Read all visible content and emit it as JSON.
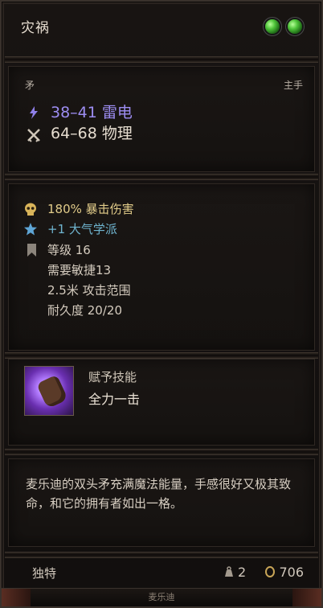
{
  "item": {
    "name": "灾祸",
    "type": "矛",
    "slot": "主手",
    "damage": [
      {
        "icon": "lightning-icon",
        "text": "38–41 雷电",
        "color": "#9d8df2"
      },
      {
        "icon": "crossed-swords-icon",
        "text": "64–68 物理",
        "color": "#e6ddd0"
      }
    ],
    "stats": [
      {
        "icon": "skull-icon",
        "text": "180% 暴击伤害",
        "color": "#e2cc8a"
      },
      {
        "icon": "star-icon",
        "text": "+1 大气学派",
        "color": "#6fb4cf"
      },
      {
        "icon": "bookmark-icon",
        "text": "等级 16",
        "color": "#d5ccbf"
      },
      {
        "icon": "",
        "text": "需要敏捷13",
        "color": "#d5ccbf"
      },
      {
        "icon": "",
        "text": "2.5米 攻击范围",
        "color": "#d5ccbf"
      },
      {
        "icon": "",
        "text": "耐久度 20/20",
        "color": "#d5ccbf"
      }
    ],
    "skill": {
      "label": "赋予技能",
      "name": "全力一击"
    },
    "description": "麦乐迪的双头矛充满魔法能量，手感很好又极其致命，和它的拥有者如出一格。",
    "rarity": "独特",
    "weight": "2",
    "value": "706",
    "owner": "麦乐迪"
  }
}
